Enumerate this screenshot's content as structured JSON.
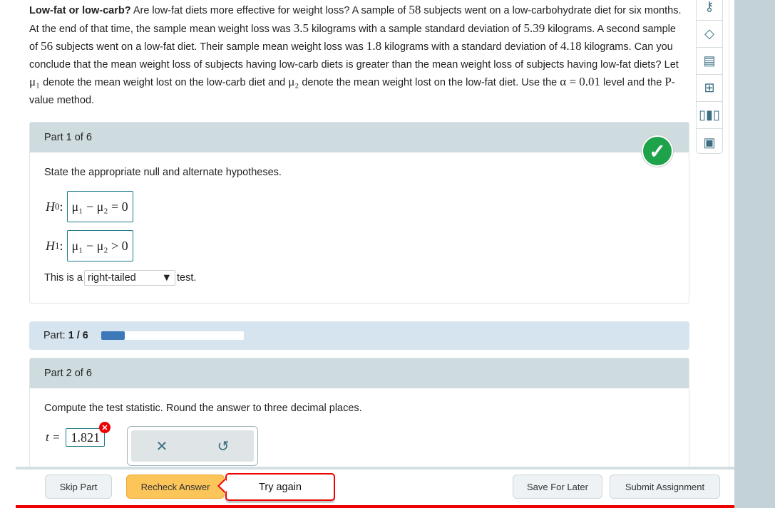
{
  "problem": {
    "segments": [
      {
        "t": "Low-fat or low-carb?",
        "s": "bold"
      },
      {
        "t": " Are low-fat diets more effective for weight loss? A sample of "
      },
      {
        "t": "58",
        "s": "num"
      },
      {
        "t": " subjects went on a low-carbohydrate diet for six months. At the end of that time, the sample mean weight loss was "
      },
      {
        "t": "3.5",
        "s": "num"
      },
      {
        "t": " kilograms with a sample standard deviation of "
      },
      {
        "t": "5.39",
        "s": "num"
      },
      {
        "t": " kilograms. A second sample of "
      },
      {
        "t": "56",
        "s": "num"
      },
      {
        "t": " subjects went on a low-fat diet. Their sample mean weight loss was "
      },
      {
        "t": "1.8",
        "s": "num"
      },
      {
        "t": " kilograms with a standard deviation of "
      },
      {
        "t": "4.18",
        "s": "num"
      },
      {
        "t": " kilograms. Can you conclude that the mean weight loss of subjects having low-carb diets is greater than the mean weight loss of subjects having low-fat diets? Let "
      },
      {
        "t": "μ₁",
        "s": "num"
      },
      {
        "t": " denote the mean weight lost on the low-carb diet and "
      },
      {
        "t": "μ₂",
        "s": "num"
      },
      {
        "t": " denote the mean weight lost on the low-fat diet. Use the "
      },
      {
        "t": "α = 0.01",
        "s": "num"
      },
      {
        "t": " level and the "
      },
      {
        "t": "P",
        "s": "num"
      },
      {
        "t": "-value method."
      }
    ]
  },
  "sidebar": {
    "icons": [
      "key-icon",
      "redo-diamond-icon",
      "hint-document-icon",
      "ebook-icon",
      "bar-chart-icon",
      "calculator-document-icon"
    ]
  },
  "part1": {
    "header": "Part 1 of 6",
    "question": "State the appropriate null and alternate hypotheses.",
    "h0_label": "H",
    "h0_sub": "0",
    "h0_expr": "μ₁ − μ₂ = 0",
    "h1_label": "H",
    "h1_sub": "1",
    "h1_expr": "μ₁ − μ₂ > 0",
    "test_prefix": "This is a",
    "test_value": "right-tailed",
    "test_suffix": "test.",
    "status": "correct"
  },
  "progress": {
    "label": "Part:",
    "value": "1 / 6",
    "fraction": 0.1667,
    "color": "#3d79b8"
  },
  "part2": {
    "header": "Part 2 of 6",
    "question": "Compute the test statistic. Round the answer to three decimal places.",
    "t_label": "t =",
    "t_value": "1.821",
    "status": "incorrect"
  },
  "footer": {
    "skip": "Skip Part",
    "recheck": "Recheck Answer",
    "try_again": "Try again",
    "save": "Save For Later",
    "submit": "Submit Assignment"
  },
  "colors": {
    "accent": "#1c7c8a",
    "correct": "#1fa34a",
    "error": "#e00000",
    "recheck": "#fbc55a"
  }
}
